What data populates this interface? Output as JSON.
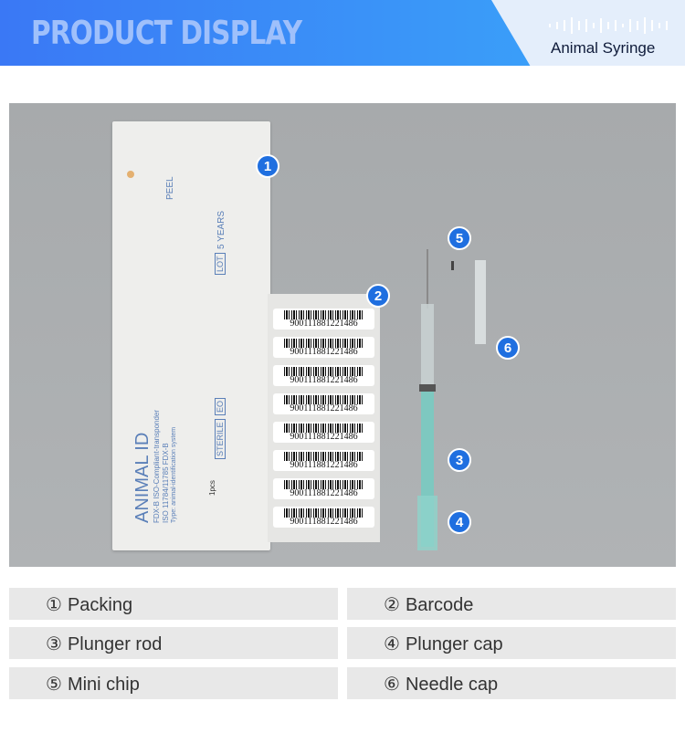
{
  "header": {
    "title": "PRODUCT DISPLAY",
    "subtitle": "Animal Syringe",
    "gradient": [
      "#3a78f5",
      "#3aa9fa"
    ]
  },
  "photo": {
    "packing_text": {
      "brand": "ANIMAL ID",
      "line1": "FDX-B  ISO-Compliant-transponder",
      "line2": "ISO 11784/11785 FDX-B",
      "line3": "Type: animal-identification system",
      "lot": "LOT",
      "years": "5 YEARS",
      "peel": "PEEL",
      "sterile": "STERILE",
      "eo": "EO",
      "qty": "1pcs"
    },
    "barcodes": [
      "900111881221486",
      "900111881221486",
      "900111881221486",
      "900111881221486",
      "900111881221486",
      "900111881221486",
      "900111881221486",
      "900111881221486"
    ],
    "badges": [
      "1",
      "2",
      "3",
      "4",
      "5",
      "6"
    ]
  },
  "labels": [
    {
      "num": "①",
      "text": "Packing"
    },
    {
      "num": "②",
      "text": "Barcode"
    },
    {
      "num": "③",
      "text": "Plunger rod"
    },
    {
      "num": "④",
      "text": "Plunger cap"
    },
    {
      "num": "⑤",
      "text": "Mini chip"
    },
    {
      "num": "⑥",
      "text": "Needle cap"
    }
  ]
}
